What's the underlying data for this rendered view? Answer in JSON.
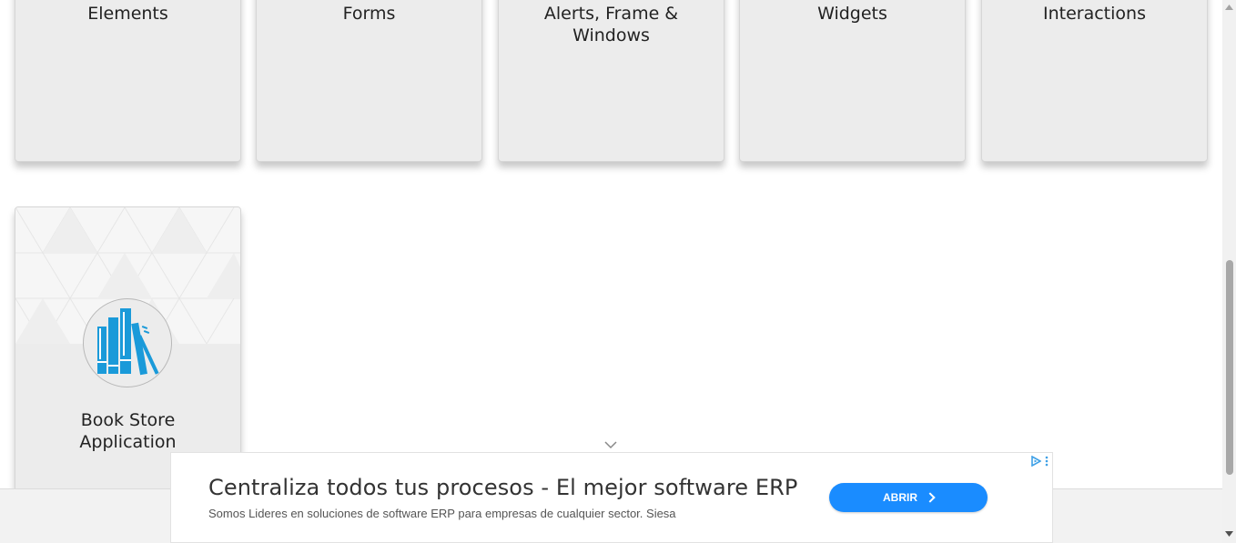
{
  "cards": [
    {
      "title": "Elements"
    },
    {
      "title": "Forms"
    },
    {
      "title": "Alerts, Frame & Windows"
    },
    {
      "title": "Widgets"
    },
    {
      "title": "Interactions"
    },
    {
      "title": "Book Store Application"
    }
  ],
  "ad": {
    "headline": "Centraliza todos tus procesos - El mejor software ERP",
    "description": "Somos Lideres en soluciones de software ERP para empresas de cualquier sector. Siesa",
    "button_label": "ABRIR",
    "icons": [
      "ad-choices-icon",
      "more-options-icon",
      "chevron-down-icon"
    ]
  },
  "colors": {
    "card_background": "#ececec",
    "book_icon": "#1a9ad9",
    "ad_button": "#1a8cff",
    "ad_choices": "#3ea0e6"
  }
}
